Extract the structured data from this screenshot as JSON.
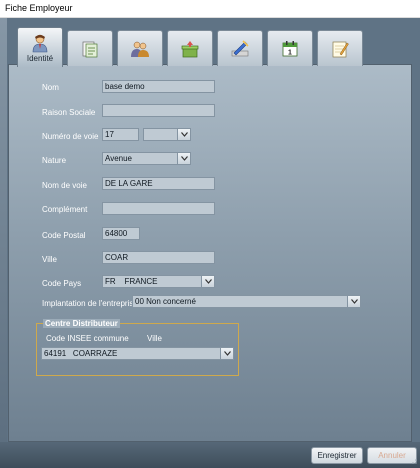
{
  "window": {
    "title": "Fiche Employeur"
  },
  "tabs": [
    {
      "label": "Identité",
      "icon": "person-icon",
      "active": true
    },
    {
      "label": "",
      "icon": "documents-icon",
      "active": false
    },
    {
      "label": "",
      "icon": "group-icon",
      "active": false
    },
    {
      "label": "",
      "icon": "box-icon",
      "active": false
    },
    {
      "label": "",
      "icon": "tools-icon",
      "active": false
    },
    {
      "label": "",
      "icon": "calendar-icon",
      "active": false
    },
    {
      "label": "",
      "icon": "notepad-icon",
      "active": false
    }
  ],
  "form": {
    "nom": {
      "label": "Nom",
      "value": "base demo"
    },
    "raison_sociale": {
      "label": "Raison Sociale",
      "value": ""
    },
    "numero_voie": {
      "label": "Numéro de voie",
      "value": "17",
      "suffix": ""
    },
    "nature": {
      "label": "Nature",
      "value": "Avenue"
    },
    "nom_voie": {
      "label": "Nom de voie",
      "value": "DE LA GARE"
    },
    "complement": {
      "label": "Complément",
      "value": ""
    },
    "code_postal": {
      "label": "Code Postal",
      "value": "64800"
    },
    "ville": {
      "label": "Ville",
      "value": "COAR"
    },
    "code_pays": {
      "label": "Code Pays",
      "value": "FR    FRANCE"
    },
    "implantation": {
      "label": "Implantation de l'entreprise",
      "value": "00 Non concerné"
    }
  },
  "centre": {
    "legend": "Centre Distributeur",
    "col_code": "Code INSEE commune",
    "col_ville": "Ville",
    "value": "64191   COARRAZE"
  },
  "buttons": {
    "save": "Enregistrer",
    "cancel": "Annuler"
  },
  "colors": {
    "panel_top": "#acbbc7",
    "panel_bottom": "#6e8090",
    "fieldset_border": "#cfa94c",
    "field_bg": "#bfcad3"
  }
}
